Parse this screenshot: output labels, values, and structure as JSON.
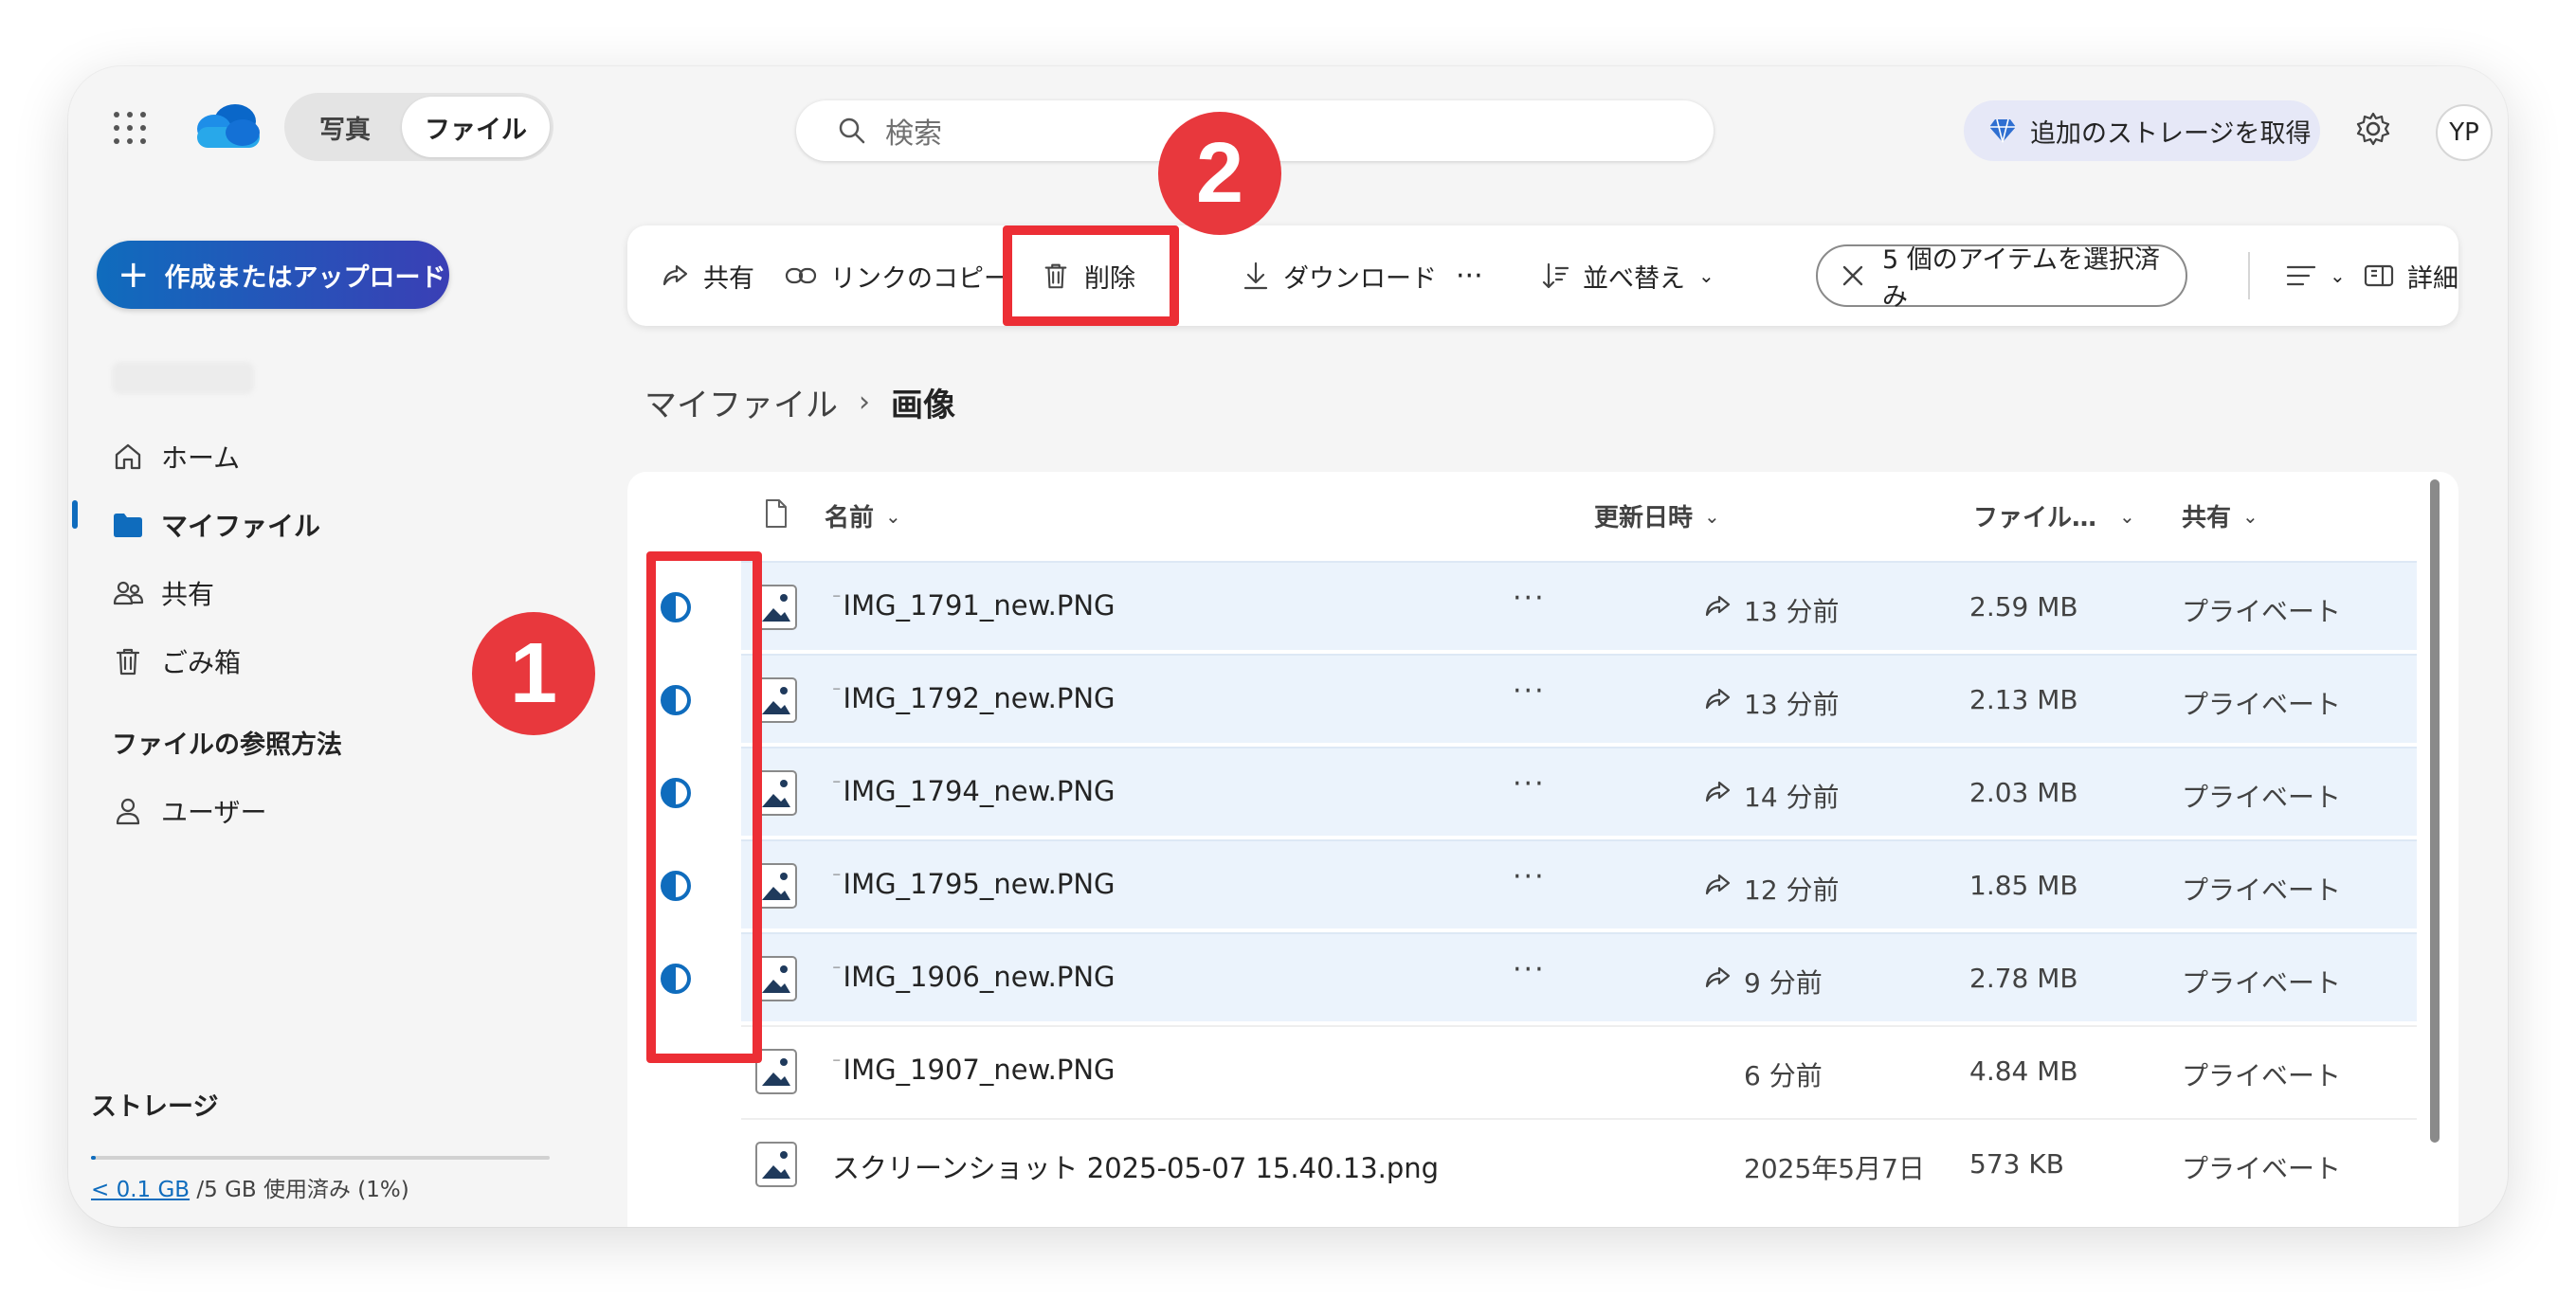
{
  "header": {
    "tabs": [
      "写真",
      "ファイル"
    ],
    "search_placeholder": "検索",
    "premium_label": "追加のストレージを取得",
    "avatar_initials": "YP"
  },
  "sidebar": {
    "create_label": "作成またはアップロード",
    "items": [
      {
        "label": "ホーム",
        "icon": "home-icon"
      },
      {
        "label": "マイファイル",
        "icon": "folder-icon",
        "active": true
      },
      {
        "label": "共有",
        "icon": "people-icon"
      },
      {
        "label": "ごみ箱",
        "icon": "trash-icon"
      }
    ],
    "section_title": "ファイルの参照方法",
    "section_items": [
      {
        "label": "ユーザー",
        "icon": "person-icon"
      }
    ],
    "storage_title": "ストレージ",
    "storage_used": "< 0.1 GB",
    "storage_rest": "/5 GB 使用済み (1%)",
    "storage_fraction": 0.01
  },
  "commandbar": {
    "share": "共有",
    "copy_link": "リンクのコピー",
    "delete": "削除",
    "download": "ダウンロード",
    "more": "···",
    "sort": "並べ替え",
    "selection": "5 個のアイテムを選択済み",
    "details": "詳細"
  },
  "annotations": {
    "badge1": "1",
    "badge2": "2"
  },
  "breadcrumb": {
    "root": "マイファイル",
    "current": "画像"
  },
  "table": {
    "columns": {
      "name": "名前",
      "modified": "更新日時",
      "size": "ファイル…",
      "sharing": "共有"
    },
    "rows": [
      {
        "name": "IMG_1791_new.PNG",
        "modified": "13 分前",
        "size": "2.59 MB",
        "sharing": "プライベート",
        "selected": true
      },
      {
        "name": "IMG_1792_new.PNG",
        "modified": "13 分前",
        "size": "2.13 MB",
        "sharing": "プライベート",
        "selected": true
      },
      {
        "name": "IMG_1794_new.PNG",
        "modified": "14 分前",
        "size": "2.03 MB",
        "sharing": "プライベート",
        "selected": true
      },
      {
        "name": "IMG_1795_new.PNG",
        "modified": "12 分前",
        "size": "1.85 MB",
        "sharing": "プライベート",
        "selected": true
      },
      {
        "name": "IMG_1906_new.PNG",
        "modified": "9 分前",
        "size": "2.78 MB",
        "sharing": "プライベート",
        "selected": true
      },
      {
        "name": "IMG_1907_new.PNG",
        "modified": "6 分前",
        "size": "4.84 MB",
        "sharing": "プライベート",
        "selected": false
      },
      {
        "name": "スクリーンショット 2025-05-07 15.40.13.png",
        "modified": "2025年5月7日",
        "size": "573 KB",
        "sharing": "プライベート",
        "selected": false
      }
    ]
  },
  "colors": {
    "accent": "#0f6cbd",
    "highlight": "#ec2e35",
    "selected_row": "#ebf3fc"
  }
}
